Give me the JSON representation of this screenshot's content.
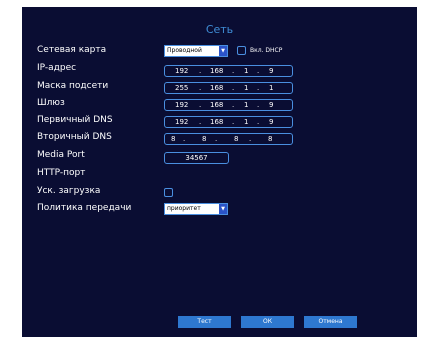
{
  "window": {
    "title": "Сеть"
  },
  "labels": {
    "network_card": "Сетевая карта",
    "ip": "IP-адрес",
    "mask": "Маска подсети",
    "gateway": "Шлюз",
    "dns1": "Первичный DNS",
    "dns2": "Вторичный DNS",
    "media_port": "Media Port",
    "http_port": "HTTP-порт",
    "fast_download": "Уск. загрузка",
    "transfer_policy": "Политика передачи"
  },
  "network_card": {
    "value": "Проводной"
  },
  "dhcp": {
    "label": "Вкл. DHCP",
    "checked": false
  },
  "ip": [
    "192",
    "168",
    "1",
    "9"
  ],
  "mask": [
    "255",
    "168",
    "1",
    "1"
  ],
  "gateway": [
    "192",
    "168",
    "1",
    "9"
  ],
  "dns1": [
    "192",
    "168",
    "1",
    "9"
  ],
  "dns2": [
    "8",
    "8",
    "8",
    "8"
  ],
  "media_port": "34567",
  "fast_download": {
    "checked": false
  },
  "transfer_policy": {
    "value": "приоритет"
  },
  "buttons": {
    "test": "Тест",
    "ok": "ОК",
    "cancel": "Отмена"
  },
  "colors": {
    "background": "#0a0d33",
    "accent": "#4a8fe0",
    "title": "#3f8dd6",
    "button": "#2e78d0"
  }
}
